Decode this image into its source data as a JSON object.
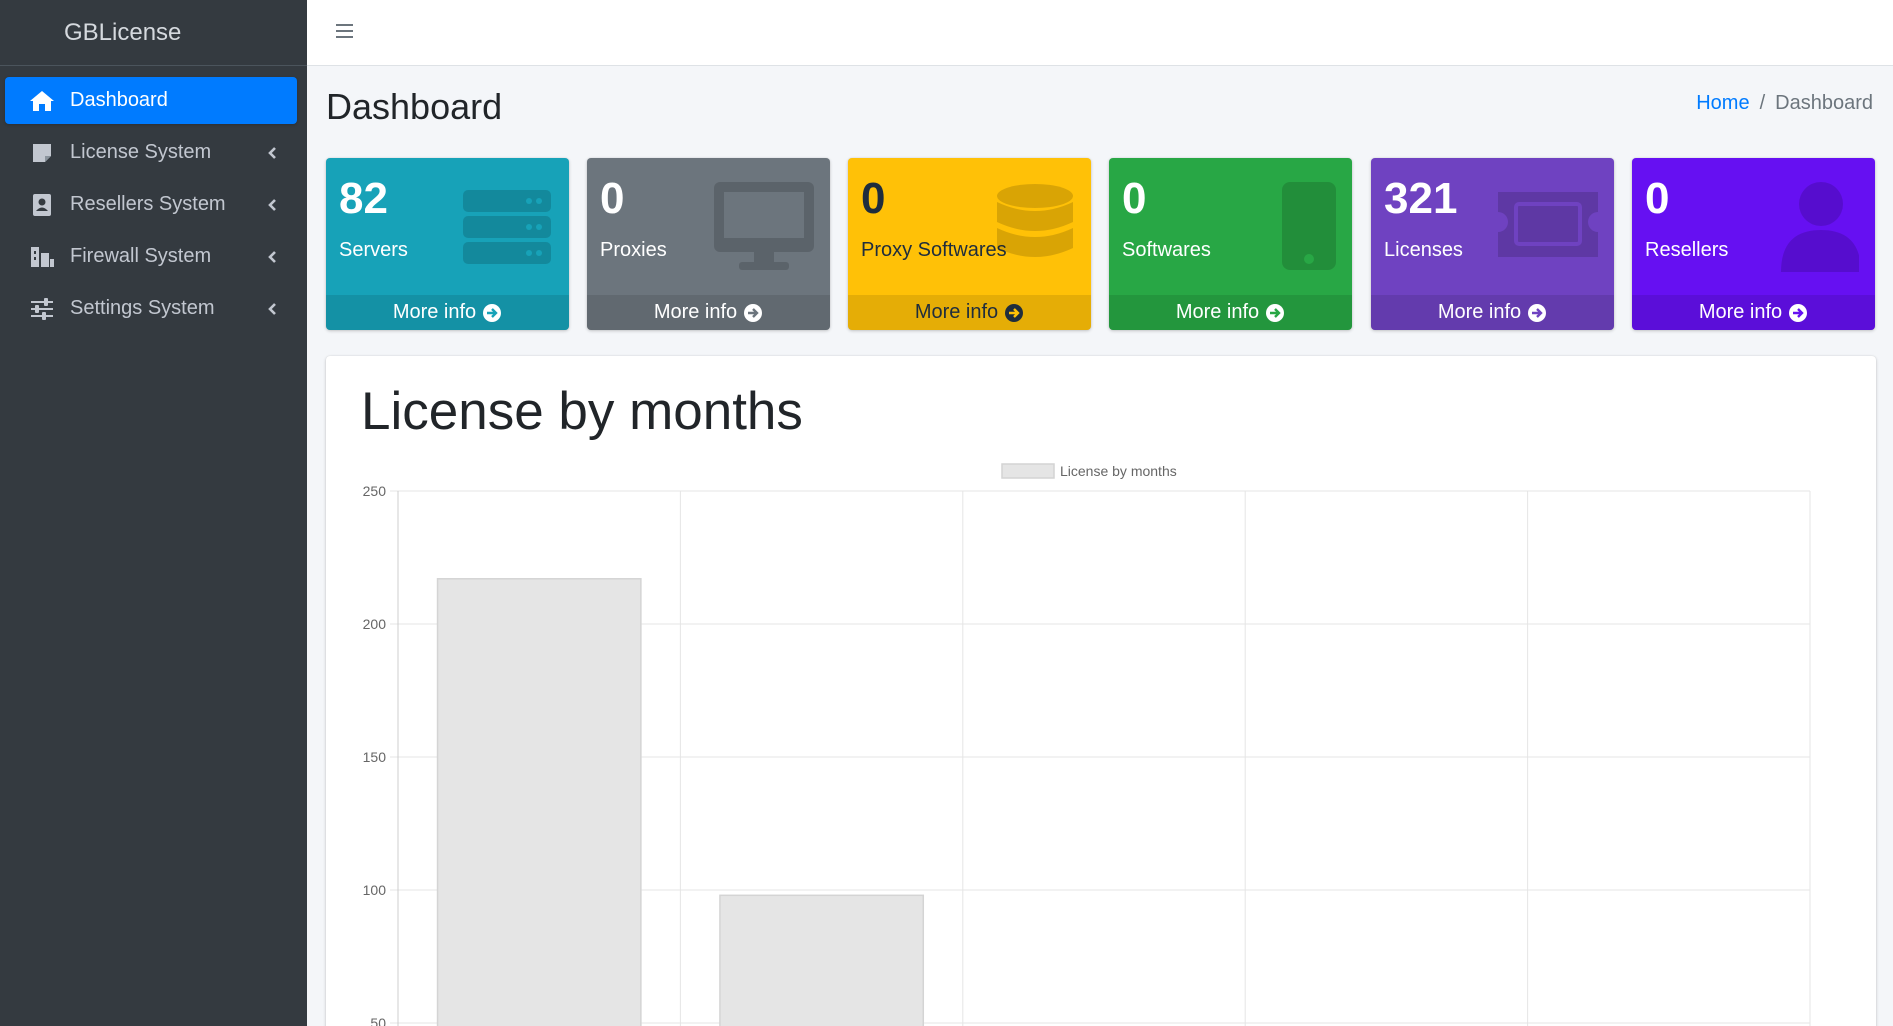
{
  "brand": "GBLicense",
  "sidebar": {
    "items": [
      {
        "label": "Dashboard",
        "icon": "home-icon",
        "active": true
      },
      {
        "label": "License System",
        "icon": "sticky-note-icon",
        "active": false
      },
      {
        "label": "Resellers System",
        "icon": "id-badge-icon",
        "active": false
      },
      {
        "label": "Firewall System",
        "icon": "firewall-icon",
        "active": false
      },
      {
        "label": "Settings System",
        "icon": "sliders-icon",
        "active": false
      }
    ]
  },
  "header": {
    "title": "Dashboard",
    "breadcrumb": {
      "home": "Home",
      "separator": "/",
      "current": "Dashboard"
    }
  },
  "boxes": [
    {
      "value": "82",
      "label": "Servers",
      "more": "More info",
      "color": "#17a2b8",
      "icon": "server-icon"
    },
    {
      "value": "0",
      "label": "Proxies",
      "more": "More info",
      "color": "#6c757d",
      "icon": "desktop-icon"
    },
    {
      "value": "0",
      "label": "Proxy Softwares",
      "more": "More info",
      "color": "#ffc107",
      "icon": "database-icon"
    },
    {
      "value": "0",
      "label": "Softwares",
      "more": "More info",
      "color": "#28a745",
      "icon": "mobile-icon"
    },
    {
      "value": "321",
      "label": "Licenses",
      "more": "More info",
      "color": "#6f42c1",
      "icon": "ticket-icon"
    },
    {
      "value": "0",
      "label": "Resellers",
      "more": "More info",
      "color": "#6610f2",
      "icon": "user-icon"
    }
  ],
  "card": {
    "title": "License by months"
  },
  "chart_data": {
    "type": "bar",
    "title": "",
    "legend": "License by months",
    "legend_position": "top",
    "categories": [
      "",
      "",
      "",
      "",
      ""
    ],
    "values": [
      217,
      98,
      null,
      null,
      null
    ],
    "ylim": [
      50,
      250
    ],
    "yticks": [
      "250",
      "200",
      "150",
      "100",
      "50"
    ],
    "xlabel": "",
    "ylabel": "",
    "grid": true,
    "bar_color": "#e5e5e5"
  }
}
